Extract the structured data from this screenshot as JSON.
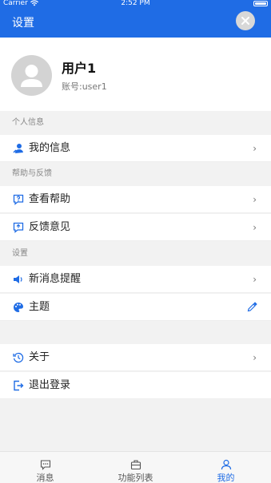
{
  "status_bar": {
    "carrier": "Carrier",
    "time": "2:52 PM"
  },
  "header": {
    "title": "设置"
  },
  "profile": {
    "name": "用户1",
    "account": "账号:user1"
  },
  "sections": {
    "personal": "个人信息",
    "help": "帮助与反馈",
    "settings": "设置"
  },
  "items": {
    "my_info": "我的信息",
    "view_help": "查看帮助",
    "feedback": "反馈意见",
    "new_message_reminder": "新消息提醒",
    "theme": "主题",
    "about": "关于",
    "logout": "退出登录"
  },
  "chevron": "›",
  "tabbar": {
    "tabs": [
      {
        "label": "消息",
        "icon": "message-icon"
      },
      {
        "label": "功能列表",
        "icon": "toolbox-icon"
      },
      {
        "label": "我的",
        "icon": "person-icon"
      }
    ],
    "active": "我的"
  },
  "colors": {
    "primary": "#1f6ce5",
    "background": "#f2f2f2"
  }
}
